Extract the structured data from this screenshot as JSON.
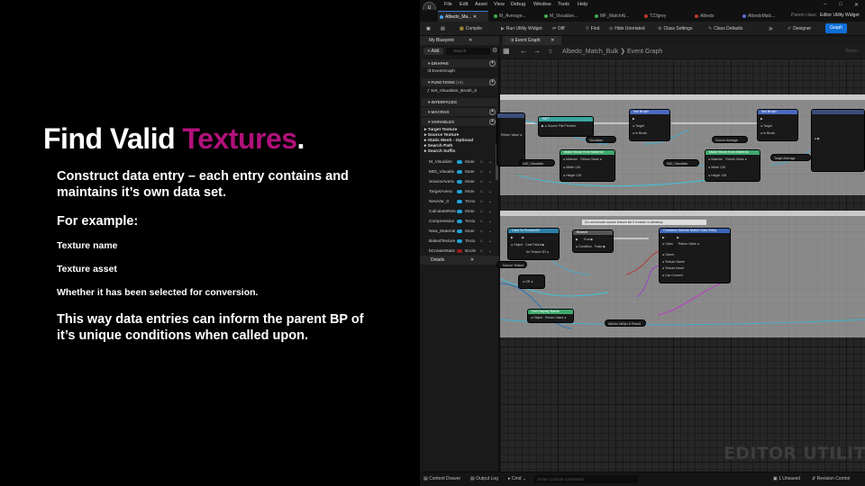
{
  "slide": {
    "title_main": "Find Valid ",
    "title_accent": "Textures",
    "title_end": ".",
    "intro": "Construct data entry – each entry contains and maintains it’s own data set.",
    "example_heading": "For example:",
    "example_items": [
      "Texture name",
      "Texture asset",
      "Whether it has been selected for conversion."
    ],
    "closing": "This way data entries can inform the parent BP of it’s unique conditions when called upon.",
    "accent_color": "#b0117a"
  },
  "editor": {
    "menu": [
      "File",
      "Edit",
      "Asset",
      "View",
      "Debug",
      "Window",
      "Tools",
      "Help"
    ],
    "window_controls": [
      "–",
      "□",
      "✕"
    ],
    "tabs": [
      {
        "label": "Albedo_Ma...",
        "dot": "#4aa3ff"
      },
      {
        "label": "M_Average...",
        "dot": "#3fae4e"
      },
      {
        "label": "M_Visualize...",
        "dot": "#3fae4e"
      },
      {
        "label": "MF_MatchAl...",
        "dot": "#3fae4e"
      },
      {
        "label": "T23grey",
        "dot": "#c0392b"
      },
      {
        "label": "Albedo",
        "dot": "#c0392b"
      },
      {
        "label": "AlbedoMatc...",
        "dot": "#5b6ee1"
      }
    ],
    "parent_class_label": "Parent class:",
    "parent_class_value": "Editor Utility Widget",
    "toolbar": {
      "compile": "Compile",
      "run": "Run Utility Widget",
      "diff": "Diff",
      "find": "Find",
      "hide_unrelated": "Hide Unrelated",
      "class_settings": "Class Settings",
      "class_defaults": "Class Defaults",
      "designer": "Designer",
      "graph": "Graph"
    },
    "my_blueprint_tab": "My Blueprint",
    "add_button": "+ Add",
    "search_placeholder": "Search",
    "sections": {
      "graphs": "GRAPHS",
      "functions": "FUNCTIONS",
      "functions_count": "(18)",
      "interfaces": "INTERFACES",
      "macros": "MACROS",
      "variables": "VARIABLES"
    },
    "graph_items": [
      "EventGraph"
    ],
    "function_items": [
      "Set_Visualiser_Brush_0"
    ],
    "variable_categories": [
      "Target Texture",
      "Source Texture",
      "Static Mesh - Optional",
      "Search Path",
      "Search Suffix"
    ],
    "variables": [
      {
        "name": "M_Visualize",
        "type": "Mate",
        "color": "#1fa2d6"
      },
      {
        "name": "MID_Visualis",
        "type": "Mate",
        "color": "#1fa2d6"
      },
      {
        "name": "SourceAvera",
        "type": "Mate",
        "color": "#1fa2d6"
      },
      {
        "name": "TargetAvera",
        "type": "Mate",
        "color": "#1fa2d6"
      },
      {
        "name": "NewVar_0",
        "type": "Textu",
        "color": "#1fa2d6"
      },
      {
        "name": "CalculateReso",
        "type": "Mate",
        "color": "#1fa2d6"
      },
      {
        "name": "Compression",
        "type": "Textu",
        "color": "#1fa2d6"
      },
      {
        "name": "New_Material",
        "type": "Mate",
        "color": "#1fa2d6"
      },
      {
        "name": "BakedTexture",
        "type": "Textu",
        "color": "#1fa2d6"
      },
      {
        "name": "bCreateStatic",
        "type": "Boole",
        "color": "#9b1b1b"
      }
    ],
    "details_tab": "Details",
    "graph_tab": "Event Graph",
    "breadcrumb": "Albedo_Match_Bulk ❯ Event Graph",
    "zoom": "Zoom",
    "watermark": "EDITOR UTILITY WIDGET",
    "comment_box_2": "Do not include source texture list if it exists in directory",
    "nodes": {
      "set": "SET",
      "set_brush_1": "Set Brush",
      "set_brush_2": "Set Brush",
      "make_brush_1": "Make Brush from Material",
      "make_brush_2": "Make Brush from Material",
      "cast": "Cast To Texture2D",
      "branch": "Branch",
      "construct": "Construct Albedo Match Data Entry",
      "get_name": "Get Display Name",
      "or": "OR",
      "visualiser": "Visualiser",
      "source_average": "Source Average",
      "target_average": "Target Average",
      "mid_visualiser": "MID_Visualiser",
      "mid_visualiser_2": "MID_Visualiser",
      "source_texture": "Source Texture",
      "editor_utility": "Albedo Utility Lit Result"
    },
    "status": {
      "content_drawer": "Content Drawer",
      "output_log": "Output Log",
      "cmd": "Cmd",
      "cmd_placeholder": "Enter Console Command",
      "unsaved": "1 Unsaved",
      "revision": "Revision Control"
    }
  }
}
